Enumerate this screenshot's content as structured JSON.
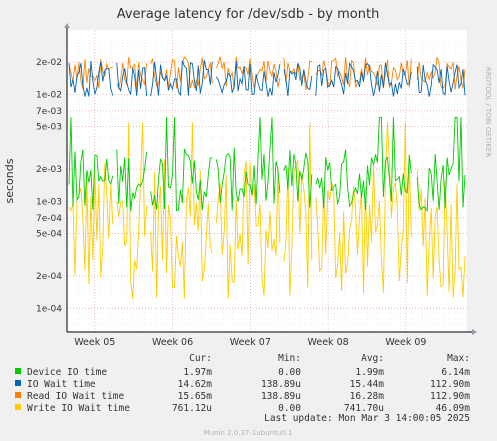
{
  "chart_data": {
    "type": "line",
    "title": "Average latency for /dev/sdb - by month",
    "ylabel": "seconds",
    "xlabel": "",
    "yscale": "log",
    "ylim": [
      6e-05,
      0.04
    ],
    "y_ticks": [
      {
        "v": 0.0001,
        "label": "1e-04"
      },
      {
        "v": 0.0002,
        "label": "2e-04"
      },
      {
        "v": 0.0005,
        "label": "5e-04"
      },
      {
        "v": 0.0007,
        "label": "7e-04"
      },
      {
        "v": 0.001,
        "label": "1e-03"
      },
      {
        "v": 0.002,
        "label": "2e-03"
      },
      {
        "v": 0.005,
        "label": "5e-03"
      },
      {
        "v": 0.007,
        "label": "7e-03"
      },
      {
        "v": 0.01,
        "label": "1e-02"
      },
      {
        "v": 0.02,
        "label": "2e-02"
      }
    ],
    "x_ticks": [
      "Week 05",
      "Week 06",
      "Week 07",
      "Week 08",
      "Week 09"
    ],
    "grid": true,
    "legend_position": "bottom",
    "side_label": "RRDTOOL / TOBI OETIKER",
    "columns": [
      "Cur:",
      "Min:",
      "Avg:",
      "Max:"
    ],
    "series": [
      {
        "name": "Device IO time",
        "color": "#00cc00",
        "cur": "1.97m",
        "min": "0.00",
        "avg": "1.99m",
        "max": "6.14m",
        "y_center": 0.0019,
        "y_range": [
          0.0008,
          0.0032
        ],
        "y_spike_max": 0.0061,
        "spike_rate": 0.05
      },
      {
        "name": "IO Wait time",
        "color": "#0066b3",
        "cur": "14.62m",
        "min": "138.89u",
        "avg": "15.44m",
        "max": "112.90m",
        "y_center": 0.0145,
        "y_range": [
          0.0095,
          0.021
        ],
        "y_spike_max": 0.022,
        "spike_rate": 0.0
      },
      {
        "name": "Read IO Wait time",
        "color": "#ff8000",
        "cur": "15.65m",
        "min": "138.89u",
        "avg": "16.28m",
        "max": "112.90m",
        "y_center": 0.0158,
        "y_range": [
          0.011,
          0.023
        ],
        "y_spike_max": 0.024,
        "spike_rate": 0.0
      },
      {
        "name": "Write IO Wait time",
        "color": "#ffcc00",
        "cur": "761.12u",
        "min": "0.00",
        "avg": "741.70u",
        "max": "46.09m",
        "y_center": 0.0005,
        "y_range": [
          0.00012,
          0.0025
        ],
        "y_spike_max": 0.0055,
        "spike_rate": 0.04
      }
    ]
  },
  "footer": {
    "last_update": "Last update: Mon Mar  3 14:00:05 2025",
    "version": "Munin 2.0.37-1ubuntu0.1"
  }
}
